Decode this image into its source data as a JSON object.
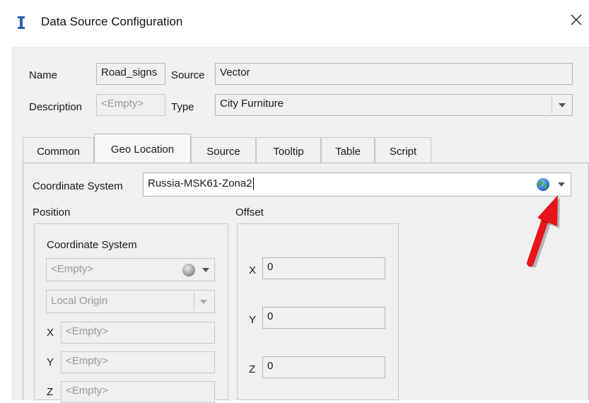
{
  "window": {
    "title": "Data Source Configuration"
  },
  "header": {
    "name_label": "Name",
    "name_value": "Road_signs",
    "source_label": "Source",
    "source_value": "Vector",
    "description_label": "Description",
    "description_value": "<Empty>",
    "type_label": "Type",
    "type_value": "City Furniture"
  },
  "tabs": [
    {
      "label": "Common"
    },
    {
      "label": "Geo Location"
    },
    {
      "label": "Source"
    },
    {
      "label": "Tooltip"
    },
    {
      "label": "Table"
    },
    {
      "label": "Script"
    }
  ],
  "geo": {
    "cs_label": "Coordinate System",
    "cs_value": "Russia-MSK61-Zona2",
    "position_label": "Position",
    "offset_label": "Offset",
    "pos_cs_label": "Coordinate System",
    "pos_cs_value": "<Empty>",
    "origin_value": "Local Origin",
    "x_label": "X",
    "x_value": "<Empty>",
    "y_label": "Y",
    "y_value": "<Empty>",
    "z_label": "Z",
    "z_value": "<Empty>",
    "offset_x_label": "X",
    "offset_x_value": "0",
    "offset_y_label": "Y",
    "offset_y_value": "0",
    "offset_z_label": "Z",
    "offset_z_value": "0"
  },
  "icons": {
    "app": "app-i-icon",
    "close": "close-icon",
    "globe": "globe-icon",
    "annotation": "red-arrow-icon"
  },
  "colors": {
    "annotation_arrow": "#e8141a",
    "globe_blue": "#1f6fd1",
    "globe_green": "#3aa84a"
  }
}
